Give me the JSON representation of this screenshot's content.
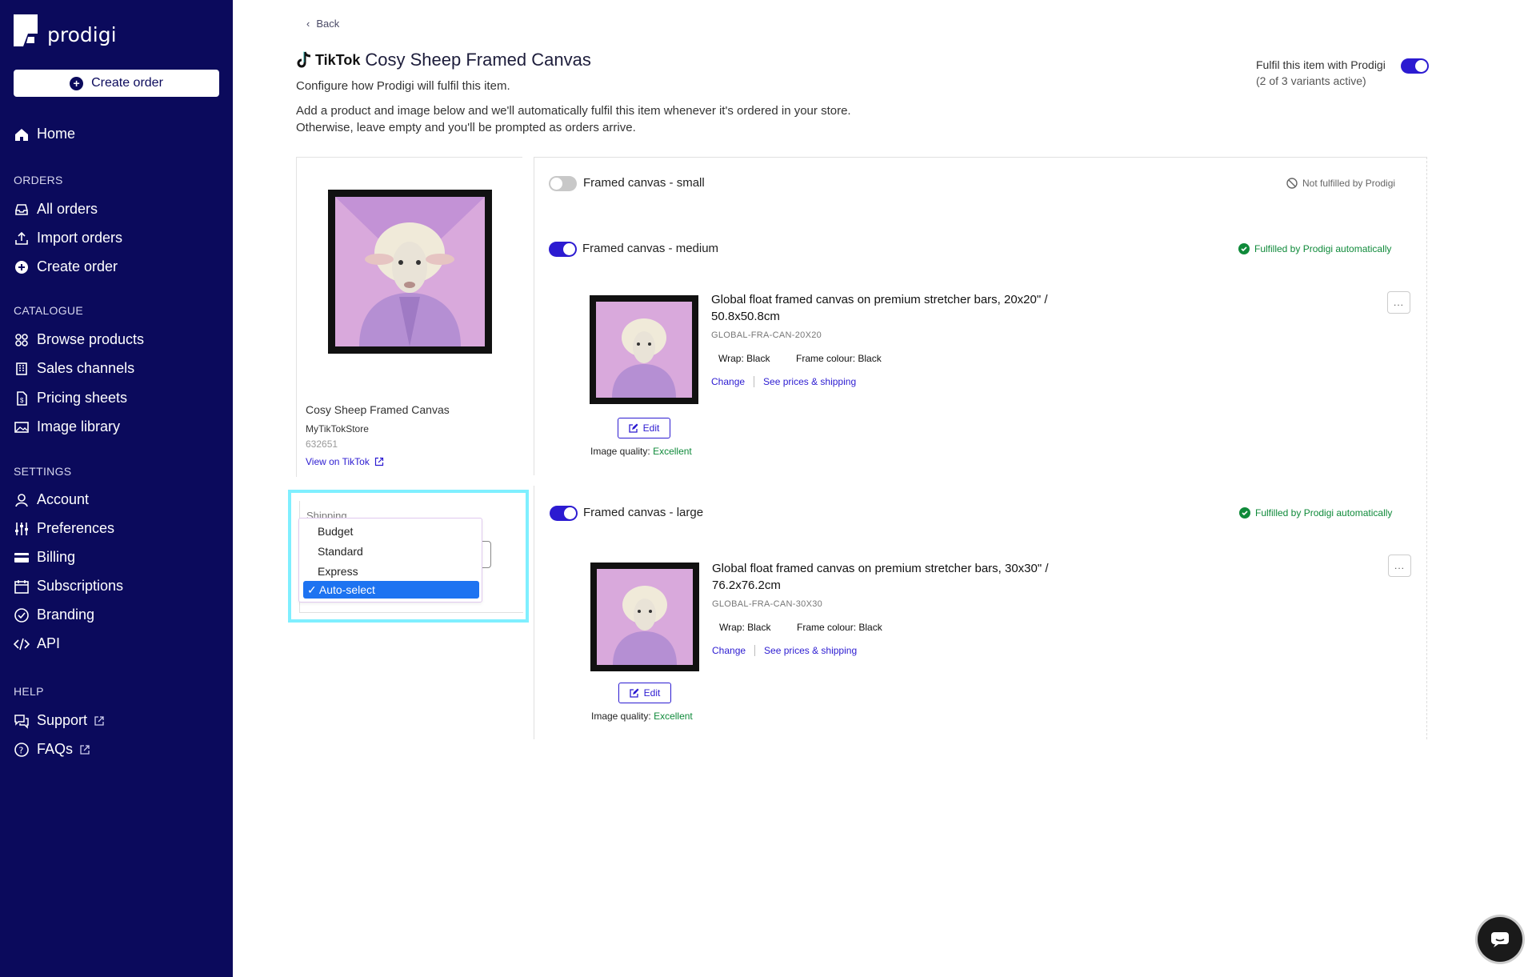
{
  "sidebar": {
    "brand": "prodigi",
    "create_order": "Create order",
    "home": "Home",
    "orders_title": "ORDERS",
    "orders": [
      "All orders",
      "Import orders",
      "Create order"
    ],
    "catalogue_title": "CATALOGUE",
    "catalogue": [
      "Browse products",
      "Sales channels",
      "Pricing sheets",
      "Image library"
    ],
    "settings_title": "SETTINGS",
    "settings": [
      "Account",
      "Preferences",
      "Billing",
      "Subscriptions",
      "Branding",
      "API"
    ],
    "help_title": "HELP",
    "help": [
      "Support",
      "FAQs"
    ]
  },
  "header": {
    "back": "Back",
    "channel": "TikTok",
    "title": "Cosy Sheep Framed Canvas",
    "subtitle": "Configure how Prodigi will fulfil this item.",
    "desc_line1": "Add a product and image below and we'll automatically fulfil this item whenever it's ordered in your store.",
    "desc_line2": "Otherwise, leave empty and you'll be prompted as orders arrive.",
    "fulfil_label": "Fulfil this item with Prodigi",
    "fulfil_sub": "(2 of 3 variants active)",
    "fulfil_on": true
  },
  "product": {
    "name": "Cosy Sheep Framed Canvas",
    "store": "MyTikTokStore",
    "id": "632651",
    "view_link": "View on TikTok"
  },
  "shipping": {
    "label": "Shipping",
    "options": [
      "Budget",
      "Standard",
      "Express",
      "Auto-select"
    ],
    "selected": "Auto-select"
  },
  "variants": [
    {
      "title": "Framed canvas - small",
      "enabled": false,
      "status": "Not fulfilled by Prodigi"
    },
    {
      "title": "Framed canvas - medium",
      "enabled": true,
      "status": "Fulfilled by Prodigi automatically",
      "product_line1": "Global float framed canvas on premium stretcher bars, 20x20\" /",
      "product_line2": "50.8x50.8cm",
      "sku": "GLOBAL-FRA-CAN-20X20",
      "wrap_label": "Wrap:",
      "wrap_value": "Black",
      "frame_label": "Frame colour:",
      "frame_value": "Black",
      "change": "Change",
      "prices": "See prices & shipping",
      "edit": "Edit",
      "quality_label": "Image quality:",
      "quality_value": "Excellent",
      "more": "..."
    },
    {
      "title": "Framed canvas - large",
      "enabled": true,
      "status": "Fulfilled by Prodigi automatically",
      "product_line1": "Global float framed canvas on premium stretcher bars, 30x30\" /",
      "product_line2": "76.2x76.2cm",
      "sku": "GLOBAL-FRA-CAN-30X30",
      "wrap_label": "Wrap:",
      "wrap_value": "Black",
      "frame_label": "Frame colour:",
      "frame_value": "Black",
      "change": "Change",
      "prices": "See prices & shipping",
      "edit": "Edit",
      "quality_label": "Image quality:",
      "quality_value": "Excellent",
      "more": "..."
    }
  ],
  "colors": {
    "sidebar": "#0b0a5c",
    "accent": "#2c1bd1",
    "success": "#0f8a3a",
    "highlight": "#7fefff",
    "selected": "#1d73f1"
  }
}
